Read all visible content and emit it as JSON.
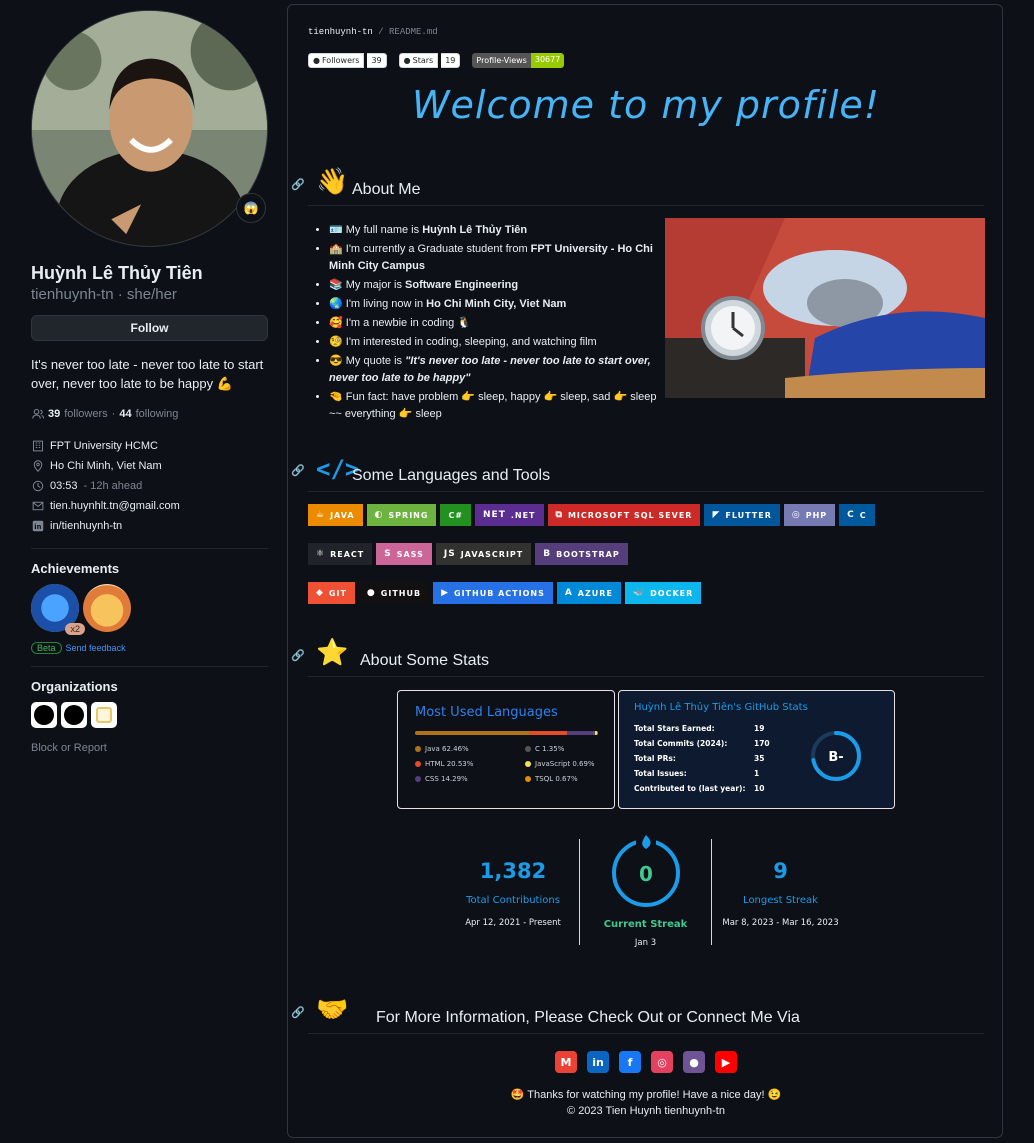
{
  "profile": {
    "full_name": "Huỳnh Lê Thủy Tiên",
    "username_line": "tienhuynh-tn · she/her",
    "follow_label": "Follow",
    "bio": "It's never too late - never too late to start over, never too late to be happy 💪",
    "followers_count": "39",
    "followers_label": "followers",
    "following_count": "44",
    "following_label": "following",
    "status_emoji": "😱",
    "details": {
      "org": "FPT University HCMC",
      "location": "Ho Chi Minh, Viet Nam",
      "time": "03:53",
      "time_note": "- 12h ahead",
      "email": "tien.huynhlt.tn@gmail.com",
      "linkedin": "in/tienhuynh-tn"
    },
    "achievements_heading": "Achievements",
    "achievement_count": "x2",
    "beta_label": "Beta",
    "feedback_label": "Send feedback",
    "organizations_heading": "Organizations",
    "block_label": "Block or Report"
  },
  "readme": {
    "breadcrumb_repo": "tienhuynh-tn",
    "breadcrumb_sep": "/",
    "breadcrumb_file": "README.md",
    "shields": {
      "followers_label": "Followers",
      "followers_value": "39",
      "stars_label": "Stars",
      "stars_value": "19",
      "views_label": "Profile-Views",
      "views_value": "30677"
    },
    "welcome": "Welcome to my profile!",
    "about": {
      "heading": "About Me",
      "items": [
        {
          "emoji": "🪪",
          "pre": "My full name is ",
          "bold": "Huỳnh Lê Thủy Tiên",
          "post": ""
        },
        {
          "emoji": "🏫",
          "pre": "I'm currently a Graduate student from ",
          "bold": "FPT University - Ho Chi Minh City Campus",
          "post": ""
        },
        {
          "emoji": "📚",
          "pre": "My major is ",
          "bold": "Software Engineering",
          "post": ""
        },
        {
          "emoji": "🌏",
          "pre": "I'm living now in ",
          "bold": "Ho Chi Minh City, Viet Nam",
          "post": ""
        },
        {
          "emoji": "🥰",
          "pre": "I'm a newbie in coding 🐧",
          "bold": "",
          "post": ""
        },
        {
          "emoji": "🧐",
          "pre": "I'm interested in coding, sleeping, and watching film",
          "bold": "",
          "post": ""
        },
        {
          "emoji": "😎",
          "pre": "My quote is ",
          "bold": "\"It's never too late - never too late to start over, never too late to be happy\"",
          "post": ""
        },
        {
          "emoji": "🤏",
          "pre": "Fun fact: have problem 👉 sleep, happy 👉 sleep, sad 👉 sleep ~~ everything 👉 sleep",
          "bold": "",
          "post": ""
        }
      ]
    },
    "tools": {
      "heading": "Some Languages and Tools",
      "row1": [
        {
          "label": "Java",
          "color": "#ED8B00",
          "icon": "☕"
        },
        {
          "label": "Spring",
          "color": "#6DB33F",
          "icon": "◐"
        },
        {
          "label": "C#",
          "color": "#239120",
          "icon": ""
        },
        {
          "label": ".Net",
          "color": "#5C2D91",
          "icon": "NET"
        },
        {
          "label": "Microsoft SQL Sever",
          "color": "#CC2927",
          "icon": "⧉"
        },
        {
          "label": "Flutter",
          "color": "#02569B",
          "icon": "◤"
        },
        {
          "label": "PHP",
          "color": "#777BB4",
          "icon": "◎"
        },
        {
          "label": "C",
          "color": "#00599C",
          "icon": "C"
        }
      ],
      "row2": [
        {
          "label": "React",
          "color": "#20232A",
          "icon": "⚛"
        },
        {
          "label": "Sass",
          "color": "#CC6699",
          "icon": "S"
        },
        {
          "label": "JavaScript",
          "color": "#323330",
          "icon": "JS"
        },
        {
          "label": "Bootstrap",
          "color": "#563D7C",
          "icon": "B"
        }
      ],
      "row3": [
        {
          "label": "Git",
          "color": "#F05033",
          "icon": "◆"
        },
        {
          "label": "GitHub",
          "color": "#121011",
          "icon": "●"
        },
        {
          "label": "GitHub Actions",
          "color": "#2671E5",
          "icon": "▶"
        },
        {
          "label": "Azure",
          "color": "#0089D6",
          "icon": "A"
        },
        {
          "label": "Docker",
          "color": "#0DB7ED",
          "icon": "🐳"
        }
      ]
    },
    "stats": {
      "heading": "About Some Stats",
      "languages_title": "Most Used Languages",
      "languages": [
        {
          "name": "Java",
          "pct": 62.46,
          "color": "#b07219"
        },
        {
          "name": "HTML",
          "pct": 20.53,
          "color": "#e34c26"
        },
        {
          "name": "CSS",
          "pct": 14.29,
          "color": "#563d7c"
        },
        {
          "name": "C",
          "pct": 1.35,
          "color": "#555555"
        },
        {
          "name": "JavaScript",
          "pct": 0.69,
          "color": "#f1e05a"
        },
        {
          "name": "TSQL",
          "pct": 0.67,
          "color": "#e38c00"
        }
      ],
      "gh_title": "Huỳnh Lê Thủy Tiên's GitHub Stats",
      "gh_rows": [
        {
          "label": "Total Stars Earned:",
          "value": "19"
        },
        {
          "label": "Total Commits (2024):",
          "value": "170"
        },
        {
          "label": "Total PRs:",
          "value": "35"
        },
        {
          "label": "Total Issues:",
          "value": "1"
        },
        {
          "label": "Contributed to (last year):",
          "value": "10"
        }
      ],
      "rank": "B-",
      "rank_progress": 0.72,
      "streak": {
        "total": "1,382",
        "total_label": "Total Contributions",
        "total_range": "Apr 12, 2021 - Present",
        "current": "0",
        "current_label": "Current Streak",
        "current_date": "Jan 3",
        "longest": "9",
        "longest_label": "Longest Streak",
        "longest_range": "Mar 8, 2023 - Mar 16, 2023"
      }
    },
    "connect": {
      "heading": "For More Information, Please Check Out or Connect Me Via",
      "icons": [
        {
          "name": "gmail-icon",
          "glyph": "M",
          "color": "#EA4335"
        },
        {
          "name": "linkedin-icon",
          "glyph": "in",
          "color": "#0A66C2"
        },
        {
          "name": "facebook-icon",
          "glyph": "f",
          "color": "#1877F2"
        },
        {
          "name": "instagram-icon",
          "glyph": "◎",
          "color": "#E4405F"
        },
        {
          "name": "github-icon",
          "glyph": "●",
          "color": "#6e5494"
        },
        {
          "name": "youtube-icon",
          "glyph": "▶",
          "color": "#FF0000"
        }
      ],
      "thanks": "🤩 Thanks for watching my profile! Have a nice day! 😉",
      "copyright": "© 2023 Tien Huynh tienhuynh-tn"
    }
  }
}
